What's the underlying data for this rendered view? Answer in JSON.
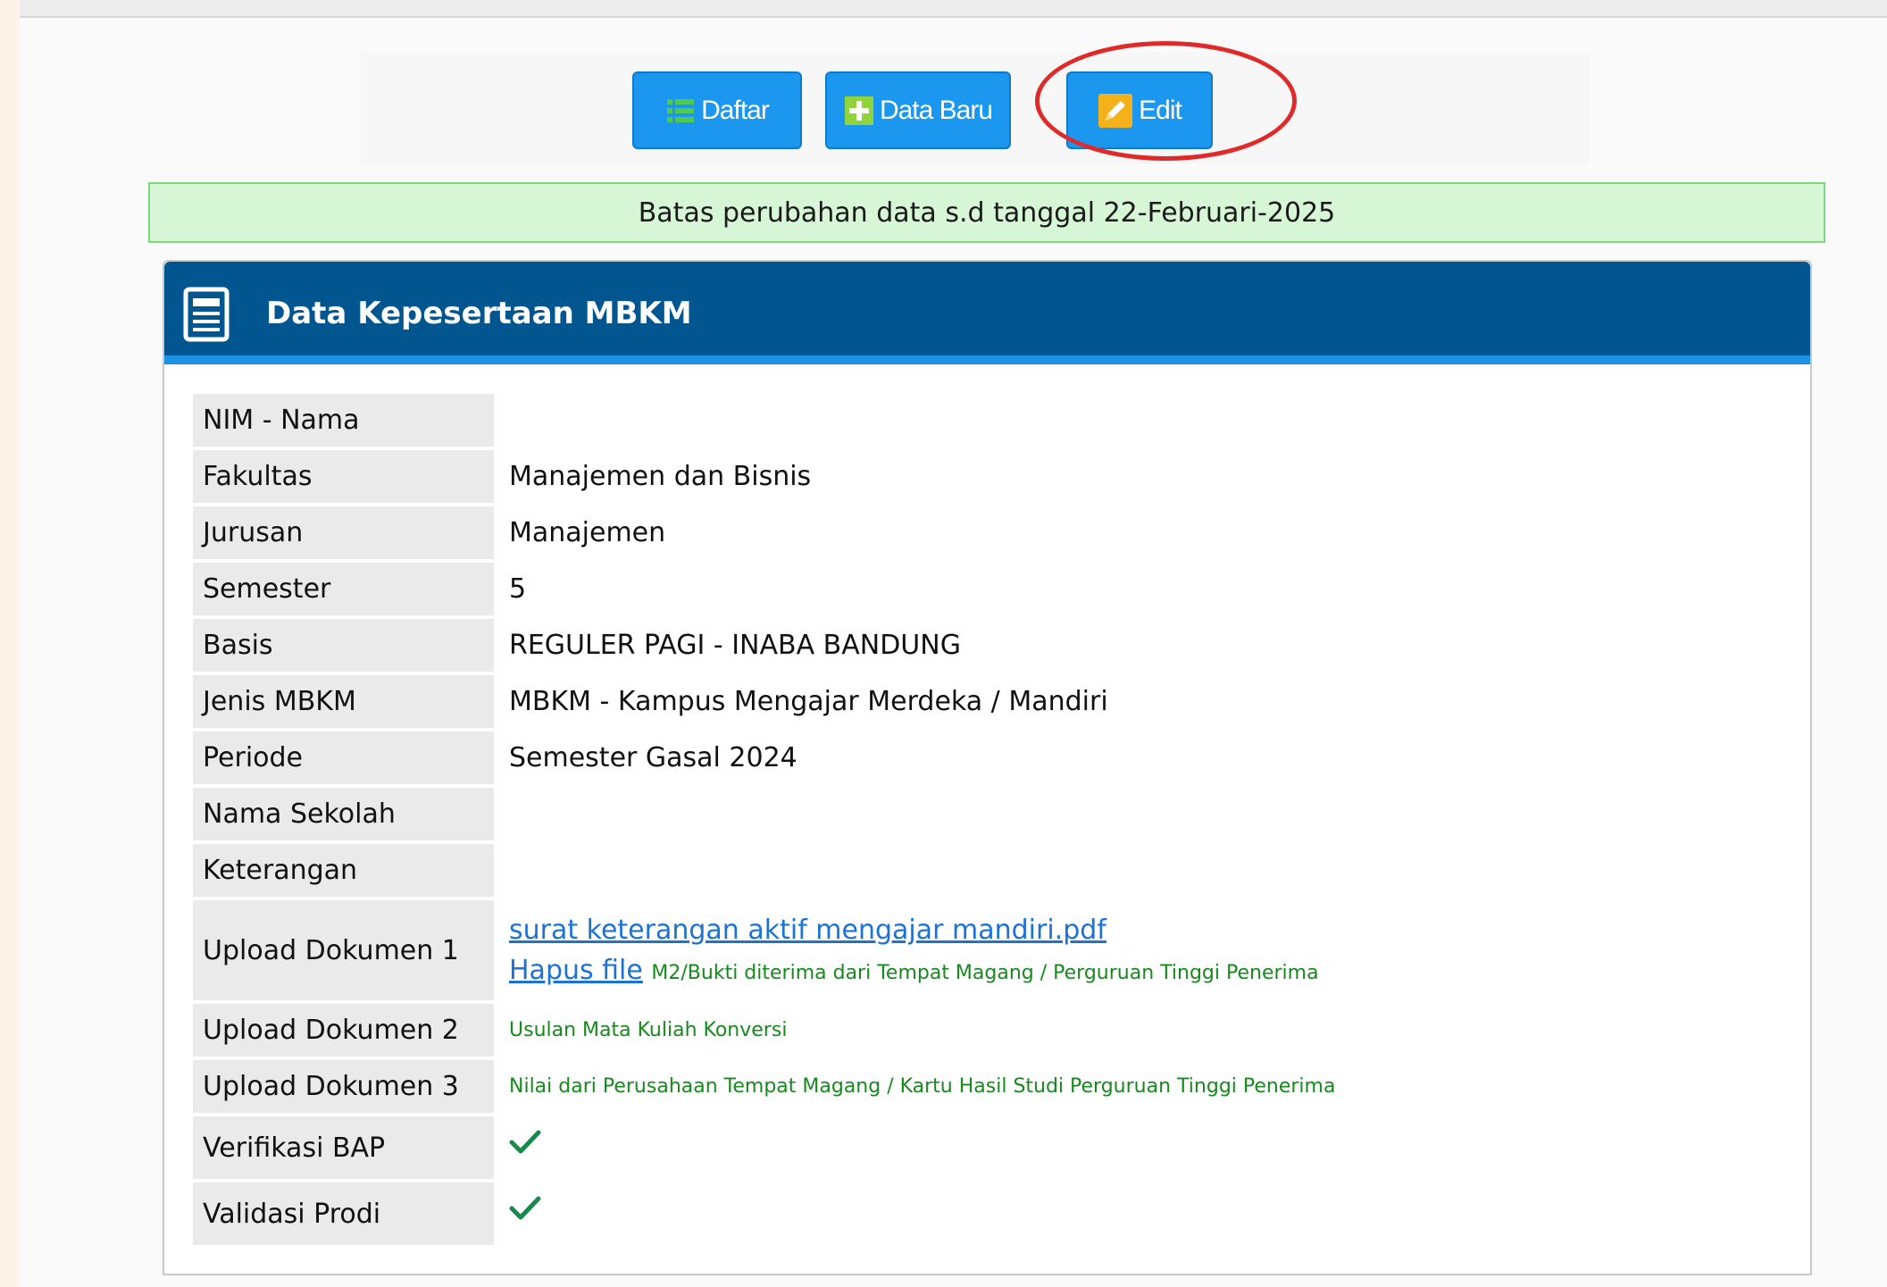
{
  "toolbar": {
    "daftar_label": "Daftar",
    "baru_label": "Data Baru",
    "edit_label": "Edit"
  },
  "notice": "Batas perubahan data s.d tanggal 22-Februari-2025",
  "panel": {
    "title": "Data Kepesertaan MBKM"
  },
  "rows": [
    {
      "label": "NIM - Nama",
      "value": ""
    },
    {
      "label": "Fakultas",
      "value": "Manajemen dan Bisnis"
    },
    {
      "label": "Jurusan",
      "value": "Manajemen"
    },
    {
      "label": "Semester",
      "value": "5"
    },
    {
      "label": "Basis",
      "value": "REGULER PAGI - INABA BANDUNG"
    },
    {
      "label": "Jenis MBKM",
      "value": "MBKM - Kampus Mengajar Merdeka / Mandiri"
    },
    {
      "label": "Periode",
      "value": "Semester Gasal 2024"
    },
    {
      "label": "Nama Sekolah",
      "value": ""
    },
    {
      "label": "Keterangan",
      "value": ""
    }
  ],
  "uploads": {
    "doc1_label": "Upload Dokumen 1",
    "doc1_file": "surat keterangan aktif mengajar mandiri.pdf",
    "doc1_delete": "Hapus file",
    "doc1_hint": "M2/Bukti diterima dari Tempat Magang / Perguruan Tinggi Penerima",
    "doc2_label": "Upload Dokumen 2",
    "doc2_hint": "Usulan Mata Kuliah Konversi",
    "doc3_label": "Upload Dokumen 3",
    "doc3_hint": "Nilai dari Perusahaan Tempat Magang / Kartu Hasil Studi Perguruan Tinggi Penerima"
  },
  "verification": {
    "bap_label": "Verifikasi BAP",
    "prodi_label": "Validasi Prodi",
    "check_icon": "check-icon"
  },
  "colors": {
    "button": "#1c97ef",
    "header": "#02568f",
    "header_rule": "#1d91e4",
    "notice_bg": "#d6f6d6",
    "highlight": "#e02a2a",
    "check": "#168a4a"
  }
}
